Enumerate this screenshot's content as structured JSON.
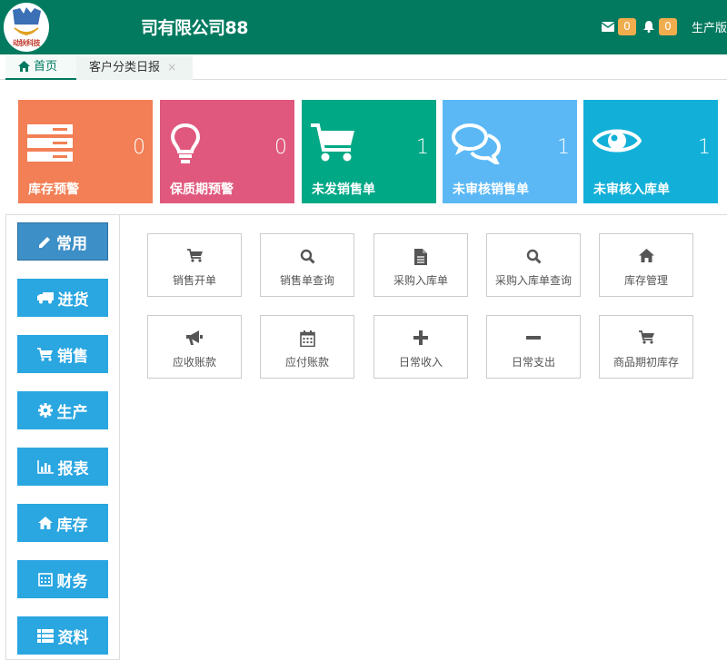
{
  "header": {
    "logo_text": "动狄科技",
    "company": "司有限公司88",
    "mail_count": "0",
    "notify_count": "0",
    "mode": "生产版"
  },
  "tabs": [
    {
      "label": "首页"
    },
    {
      "label": "客户分类日报",
      "close": "×"
    }
  ],
  "tiles": [
    {
      "label": "库存预警",
      "count": "0",
      "color": "#f27f55",
      "icon": "server-icon"
    },
    {
      "label": "保质期预警",
      "count": "0",
      "color": "#e0587d",
      "icon": "lightbulb-icon"
    },
    {
      "label": "未发销售单",
      "count": "1",
      "color": "#00a886",
      "icon": "cart-icon"
    },
    {
      "label": "未审核销售单",
      "count": "1",
      "color": "#5bb8f5",
      "icon": "comments-icon"
    },
    {
      "label": "未审核入库单",
      "count": "1",
      "color": "#12b0d8",
      "icon": "eye-icon"
    }
  ],
  "sidebar": {
    "items": [
      {
        "label": "常用",
        "icon": "pencil-icon"
      },
      {
        "label": "进货",
        "icon": "truck-icon"
      },
      {
        "label": "销售",
        "icon": "cart-icon"
      },
      {
        "label": "生产",
        "icon": "gear-icon"
      },
      {
        "label": "报表",
        "icon": "bar-chart-icon"
      },
      {
        "label": "库存",
        "icon": "home-icon"
      },
      {
        "label": "财务",
        "icon": "calendar-icon"
      },
      {
        "label": "资料",
        "icon": "list-icon"
      }
    ]
  },
  "shortcuts": [
    {
      "label": "销售开单",
      "icon": "cart-icon"
    },
    {
      "label": "销售单查询",
      "icon": "search-icon"
    },
    {
      "label": "采购入库单",
      "icon": "file-icon"
    },
    {
      "label": "采购入库单查询",
      "icon": "search-icon"
    },
    {
      "label": "库存管理",
      "icon": "home-icon"
    },
    {
      "label": "应收账款",
      "icon": "bullhorn-icon"
    },
    {
      "label": "应付账款",
      "icon": "calendar-icon"
    },
    {
      "label": "日常收入",
      "icon": "plus-icon"
    },
    {
      "label": "日常支出",
      "icon": "minus-icon"
    },
    {
      "label": "商品期初库存",
      "icon": "cart-icon"
    }
  ]
}
